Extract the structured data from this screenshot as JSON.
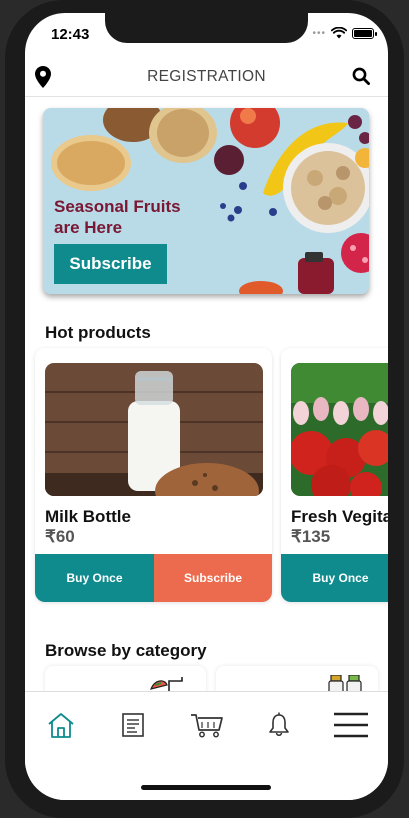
{
  "status_bar": {
    "time": "12:43"
  },
  "header": {
    "title": "REGISTRATION",
    "left_icon": "location-pin-icon",
    "right_icon": "search-icon"
  },
  "banner": {
    "text": "Seasonal Fruits are Here",
    "button_label": "Subscribe"
  },
  "hot_products": {
    "title": "Hot products",
    "items": [
      {
        "name": "Milk Bottle",
        "price": "₹60",
        "buy_label": "Buy Once",
        "subscribe_label": "Subscribe"
      },
      {
        "name": "Fresh Vegita",
        "price": "₹135",
        "buy_label": "Buy Once"
      }
    ]
  },
  "browse": {
    "title": "Browse by category"
  },
  "tab_bar": {
    "icons": [
      "home-icon",
      "document-icon",
      "cart-icon",
      "bell-icon",
      "menu-icon"
    ],
    "active": "home-icon"
  },
  "colors": {
    "primary": "#0f8b8d",
    "accent": "#ec6a4d",
    "banner_text": "#7a1733"
  }
}
